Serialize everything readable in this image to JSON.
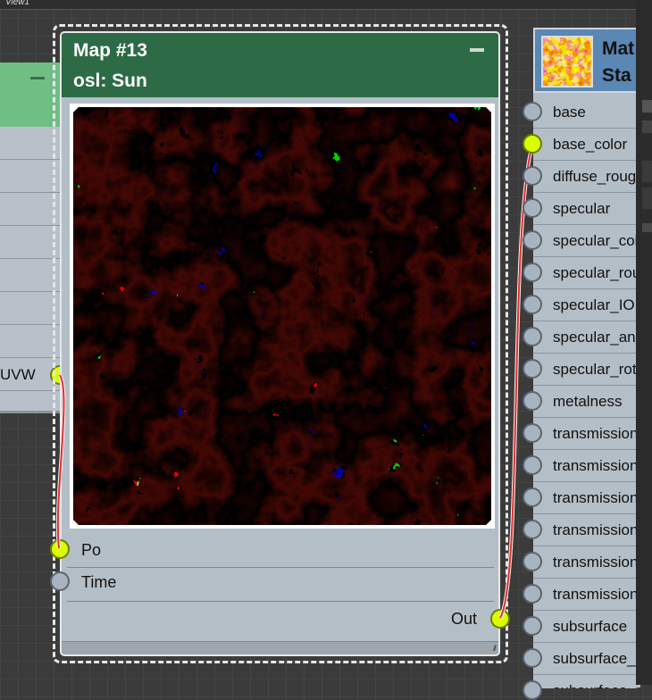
{
  "viewport": {
    "label": "View1"
  },
  "left_node": {
    "port_label": "UVW"
  },
  "map_node": {
    "title": "Map #13",
    "subtitle": "osl: Sun",
    "inputs": [
      {
        "label": "Po",
        "connected": true
      },
      {
        "label": "Time",
        "connected": false
      }
    ],
    "output": {
      "label": "Out",
      "connected": true
    }
  },
  "material_node": {
    "title_line1": "Mat",
    "title_line2": "Sta",
    "ports": [
      {
        "label": "base",
        "connected": false
      },
      {
        "label": "base_color",
        "connected": true
      },
      {
        "label": "diffuse_roughness",
        "connected": false
      },
      {
        "label": "specular",
        "connected": false
      },
      {
        "label": "specular_color",
        "connected": false
      },
      {
        "label": "specular_roughness",
        "connected": false
      },
      {
        "label": "specular_IOR",
        "connected": false
      },
      {
        "label": "specular_anisotropy",
        "connected": false
      },
      {
        "label": "specular_rotation",
        "connected": false
      },
      {
        "label": "metalness",
        "connected": false
      },
      {
        "label": "transmission",
        "connected": false
      },
      {
        "label": "transmission_color",
        "connected": false
      },
      {
        "label": "transmission_depth",
        "connected": false
      },
      {
        "label": "transmission_scatter",
        "connected": false
      },
      {
        "label": "transmission_scatter_anisotropy",
        "connected": false
      },
      {
        "label": "transmission_dispersion",
        "connected": false
      },
      {
        "label": "subsurface",
        "connected": false
      },
      {
        "label": "subsurface_color",
        "connected": false
      },
      {
        "label": "subsurface_radius",
        "connected": false
      }
    ]
  },
  "colors": {
    "connected_socket": "#d9ff00",
    "wire": "#e03030",
    "map_header": "#2d6b47",
    "material_header": "#5a87b3",
    "node_body": "#b4bec7"
  }
}
